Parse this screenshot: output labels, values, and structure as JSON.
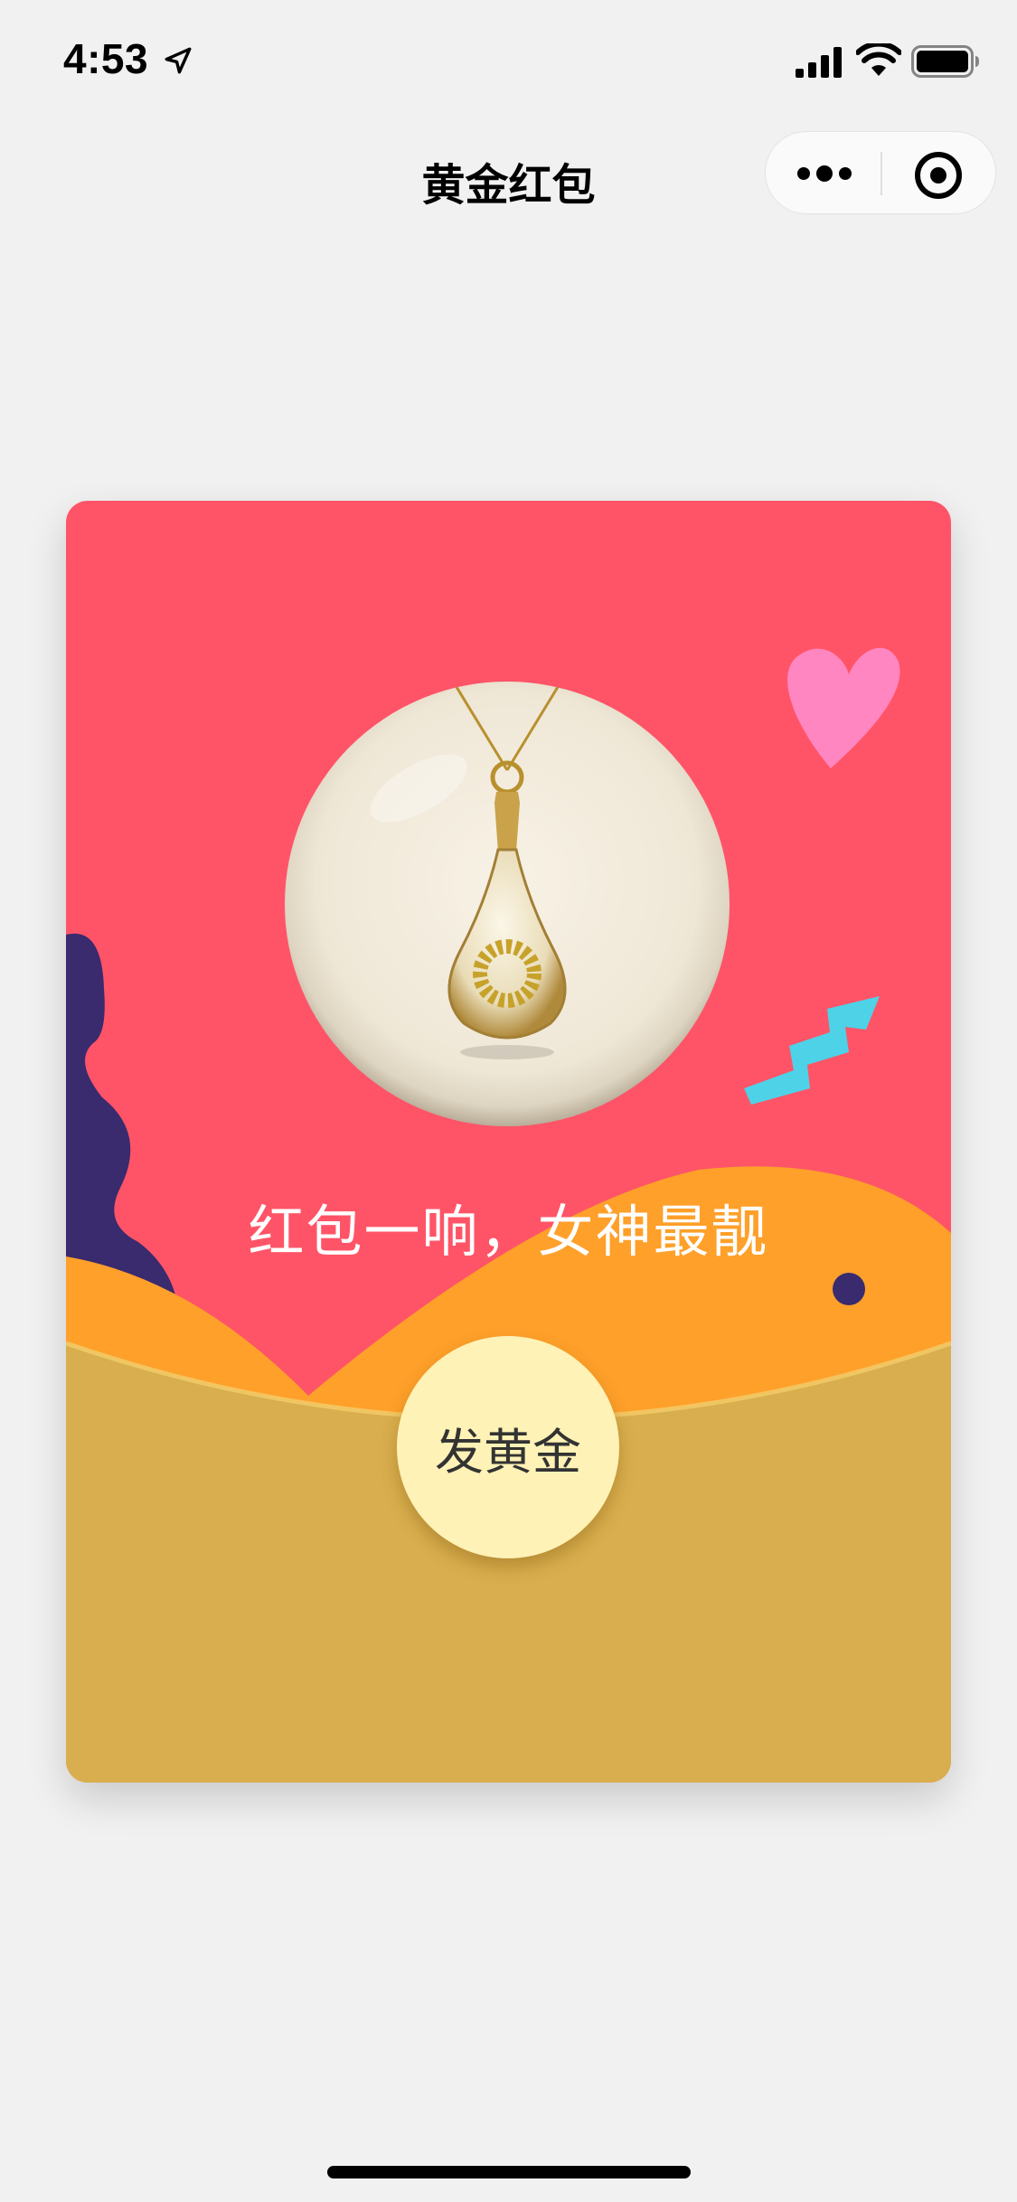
{
  "status_bar": {
    "time": "4:53",
    "icons": [
      "location-arrow-icon",
      "cellular-signal-icon",
      "wifi-icon",
      "battery-icon"
    ]
  },
  "nav": {
    "title": "黄金红包",
    "capsule_icons": [
      "more-dots-icon",
      "target-circle-icon"
    ]
  },
  "card": {
    "slogan": "红包一响，女神最靓",
    "send_button_label": "发黄金",
    "colors": {
      "red": "#ff5467",
      "orange": "#fea02a",
      "gold": "#d9ae4e",
      "button": "#fff2b6",
      "navy": "#3a2a6e",
      "pink_heart": "#ff86c0",
      "zigzag": "#4dd2e8"
    },
    "product_image": "necklace-pendant-image",
    "decorations": [
      "heart-decoration",
      "zigzag-decoration",
      "navy-wave-decoration",
      "dot-decoration"
    ]
  },
  "home_indicator": true
}
